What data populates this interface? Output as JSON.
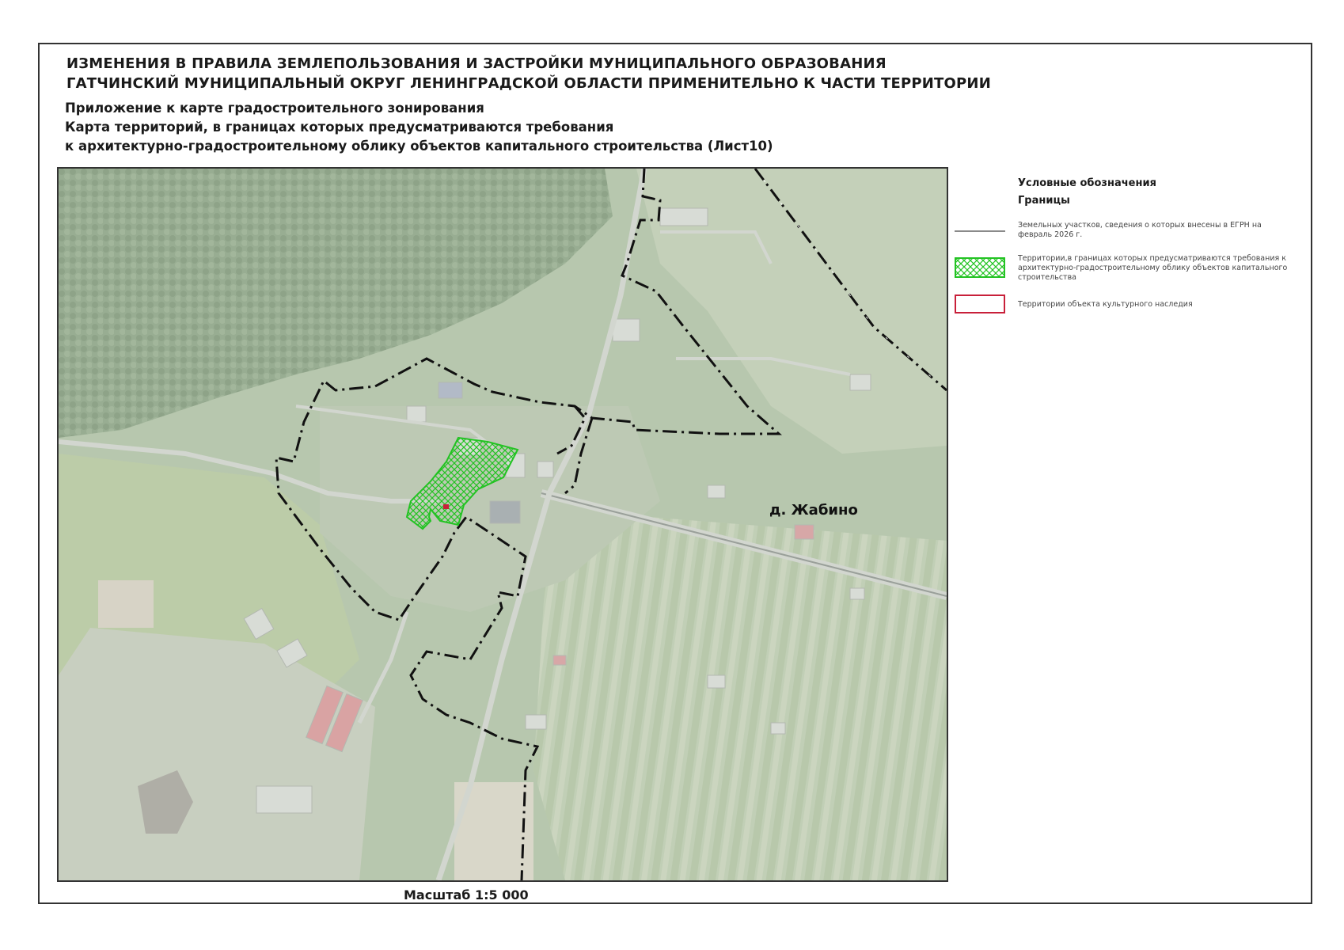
{
  "header": {
    "title_line1": "ИЗМЕНЕНИЯ В ПРАВИЛА ЗЕМЛЕПОЛЬЗОВАНИЯ И ЗАСТРОЙКИ МУНИЦИПАЛЬНОГО ОБРАЗОВАНИЯ",
    "title_line2": "ГАТЧИНСКИЙ МУНИЦИПАЛЬНЫЙ ОКРУГ ЛЕНИНГРАДСКОЙ ОБЛАСТИ ПРИМЕНИТЕЛЬНО К ЧАСТИ ТЕРРИТОРИИ",
    "subtitle_line1": "Приложение к карте градостроительного зонирования",
    "subtitle_line2": "Карта территорий, в границах которых предусматриваются требования",
    "subtitle_line3": "к архитектурно-градостроительному облику объектов капитального строительства (Лист10)"
  },
  "map": {
    "place_label": "д. Жабино",
    "scale_label": "Масштаб 1:5 000"
  },
  "legend": {
    "title": "Условные обозначения",
    "subtitle": "Границы",
    "items": [
      {
        "symbol": "grey-line",
        "color": "#8a8a8a",
        "label": "Земельных участков, сведения о которых внесены в ЕГРН на февраль 2026 г."
      },
      {
        "symbol": "green-hatch",
        "color": "#22c322",
        "label": "Территории,в границах которых предусматриваются требования к архитектурно-градостроительному облику объектов капитального строительства"
      },
      {
        "symbol": "red-outline",
        "color": "#c8203a",
        "label": "Территории объекта культурного наследия"
      }
    ]
  },
  "colors": {
    "boundary_dash": "#111111",
    "boundary_dot": "#ffffff",
    "hatch_green": "#22c322",
    "heritage_red": "#c8203a",
    "parcel_grey": "#8a8a8a"
  }
}
